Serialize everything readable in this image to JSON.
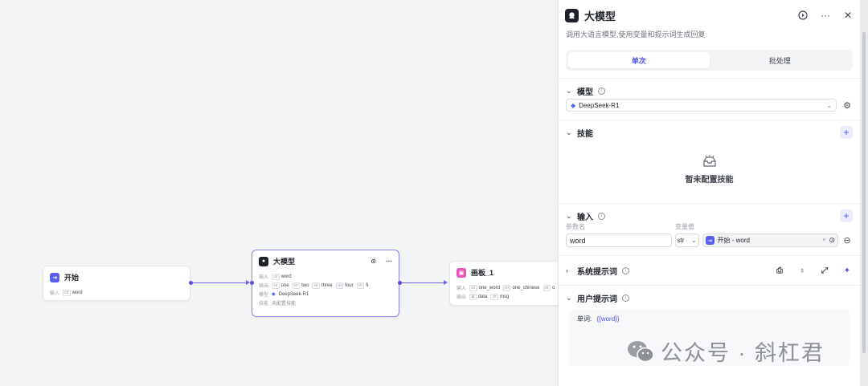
{
  "canvas": {
    "start_node": {
      "title": "开始",
      "output_label": "输入",
      "output_var": "word",
      "output_type": "str"
    },
    "llm_node": {
      "title": "大模型",
      "input_label": "输入",
      "input_var": "word",
      "output_label": "输出",
      "outputs": [
        "one",
        "two",
        "three",
        "four",
        "fi"
      ],
      "model_label": "模型",
      "model_value": "DeepSeek-R1",
      "skill_label": "技能",
      "skill_value": "未配置技能"
    },
    "canvas_node": {
      "title": "画板_1",
      "input_label": "输入",
      "inputs": [
        "one_word",
        "one_chinese",
        "o"
      ],
      "output_label": "输出",
      "outputs": [
        "data",
        "msg"
      ]
    }
  },
  "panel": {
    "title": "大模型",
    "description": "调用大语言模型,使用变量和提示词生成回复",
    "tabs": [
      "单次",
      "批处理"
    ],
    "model": {
      "section_label": "模型",
      "value": "DeepSeek-R1"
    },
    "skills": {
      "section_label": "技能",
      "empty_text": "暂未配置技能"
    },
    "input": {
      "section_label": "输入",
      "param_name_header": "参数名",
      "var_value_header": "变量值",
      "param_name": "word",
      "type_value": "str",
      "ref_value": "开始 - word"
    },
    "system_prompt": {
      "section_label": "系统提示词"
    },
    "user_prompt": {
      "section_label": "用户提示词",
      "prefix": "单词:",
      "var": "{{word}}"
    }
  },
  "watermark": {
    "text": "公众号 · 斜杠君"
  },
  "colors": {
    "accent": "#4d53e8",
    "edge": "#6e63e0",
    "start_icon": "#5b5cf0",
    "canvas_icon": "#e455b6"
  }
}
